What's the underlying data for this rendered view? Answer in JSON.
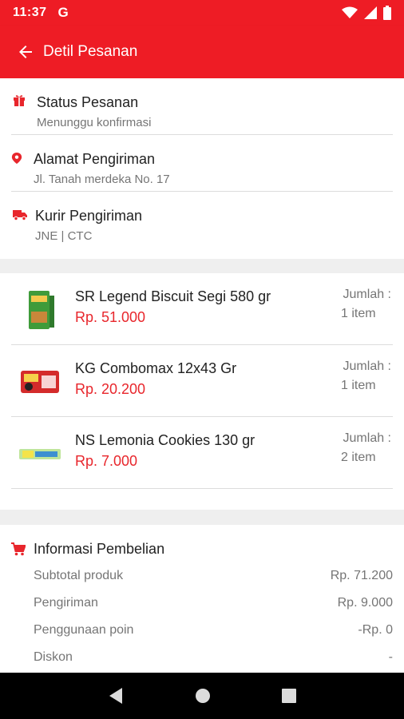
{
  "status_bar": {
    "time": "11:37",
    "google_badge": "G"
  },
  "app_bar": {
    "title": "Detil Pesanan"
  },
  "order_info": [
    {
      "label": "Status Pesanan",
      "value": "Menunggu konfirmasi",
      "icon": "gift-icon"
    },
    {
      "label": "Alamat Pengiriman",
      "value": "Jl. Tanah merdeka No. 17",
      "icon": "location-pin-icon"
    },
    {
      "label": "Kurir Pengiriman",
      "value": "JNE | CTC",
      "icon": "truck-icon"
    }
  ],
  "items": [
    {
      "name": "SR Legend Biscuit Segi 580 gr",
      "price": "Rp. 51.000",
      "qty_label": "Jumlah :",
      "qty": "1 item"
    },
    {
      "name": "KG Combomax 12x43 Gr",
      "price": "Rp. 20.200",
      "qty_label": "Jumlah :",
      "qty": "1 item"
    },
    {
      "name": "NS Lemonia Cookies 130 gr",
      "price": "Rp. 7.000",
      "qty_label": "Jumlah :",
      "qty": "2 item"
    }
  ],
  "purchase_info": {
    "title": "Informasi Pembelian",
    "rows": [
      {
        "label": "Subtotal produk",
        "value": "Rp. 71.200"
      },
      {
        "label": "Pengiriman",
        "value": "Rp. 9.000"
      },
      {
        "label": "Penggunaan poin",
        "value": "-Rp. 0"
      },
      {
        "label": "Diskon",
        "value": "-"
      }
    ]
  },
  "colors": {
    "brand_red": "#ee1c25",
    "price_red": "#e8262c",
    "muted_text": "#757575"
  }
}
